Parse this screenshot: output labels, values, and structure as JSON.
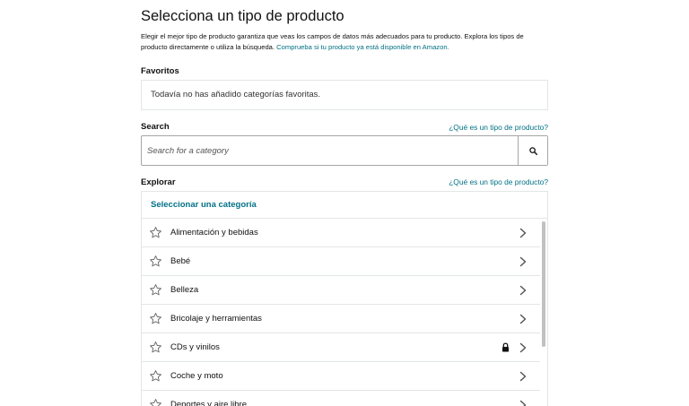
{
  "header": {
    "title": "Selecciona un tipo de producto",
    "description": "Elegir el mejor tipo de producto garantiza que veas los campos de datos más adecuados para tu producto. Explora los tipos de producto directamente o utiliza la búsqueda.",
    "description_link": "Comprueba si tu producto ya está disponible en Amazon."
  },
  "favorites": {
    "label": "Favoritos",
    "empty_text": "Todavía no has añadido categorías favoritas."
  },
  "search": {
    "label": "Search",
    "help_link": "¿Qué es un tipo de producto?",
    "placeholder": "Search for a category",
    "button_icon": "search-icon"
  },
  "explore": {
    "label": "Explorar",
    "help_link": "¿Qué es un tipo de producto?",
    "header": "Seleccionar una categoría",
    "categories": [
      {
        "label": "Alimentación y bebidas",
        "locked": false
      },
      {
        "label": "Bebé",
        "locked": false
      },
      {
        "label": "Belleza",
        "locked": false
      },
      {
        "label": "Bricolaje y herramientas",
        "locked": false
      },
      {
        "label": "CDs y vinilos",
        "locked": true
      },
      {
        "label": "Coche y moto",
        "locked": false
      },
      {
        "label": "Deportes y aire libre",
        "locked": false
      }
    ]
  },
  "colors": {
    "link": "#007185",
    "border": "#e3e6e6",
    "text": "#111111"
  }
}
